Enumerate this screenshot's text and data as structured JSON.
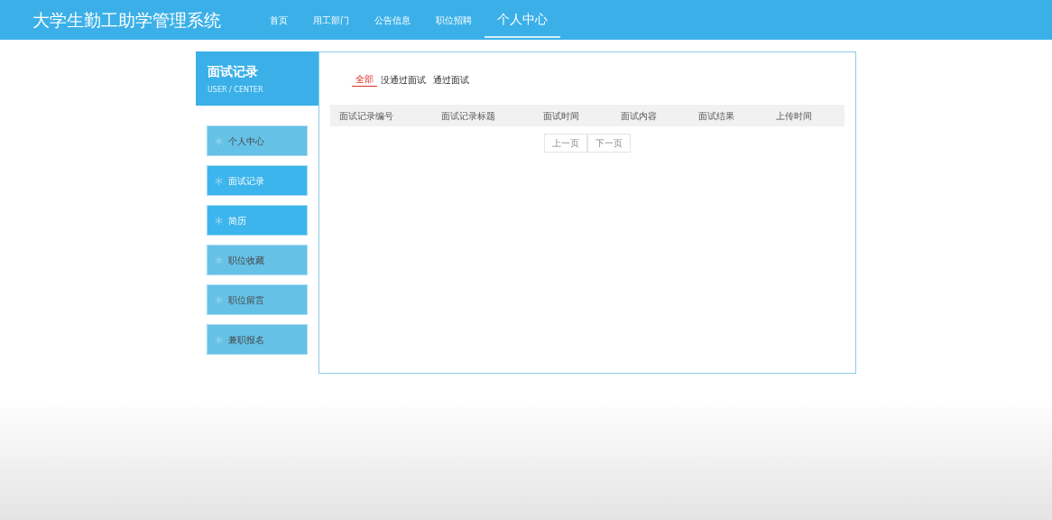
{
  "navbar": {
    "brand": "大学生勤工助学管理系统",
    "items": [
      {
        "label": "首页",
        "selected": false
      },
      {
        "label": "用工部门",
        "selected": false
      },
      {
        "label": "公告信息",
        "selected": false
      },
      {
        "label": "职位招聘",
        "selected": false
      },
      {
        "label": "个人中心",
        "selected": true
      }
    ]
  },
  "sidebar": {
    "title": "面试记录",
    "subtitle": "USER / CENTER",
    "items": [
      {
        "label": "个人中心",
        "selected": false
      },
      {
        "label": "面试记录",
        "selected": true
      },
      {
        "label": "简历",
        "selected": true
      },
      {
        "label": "职位收藏",
        "selected": false
      },
      {
        "label": "职位留言",
        "selected": false
      },
      {
        "label": "兼职报名",
        "selected": false
      }
    ]
  },
  "filter_tabs": [
    {
      "label": "全部",
      "selected": true
    },
    {
      "label": "没通过面试",
      "selected": false
    },
    {
      "label": "通过面试",
      "selected": false
    }
  ],
  "table": {
    "columns": [
      "面试记录编号",
      "面试记录标题",
      "面试时间",
      "面试内容",
      "面试结果",
      "上传时间"
    ]
  },
  "pagination": [
    {
      "label": "上一页"
    },
    {
      "label": "下一页"
    }
  ]
}
